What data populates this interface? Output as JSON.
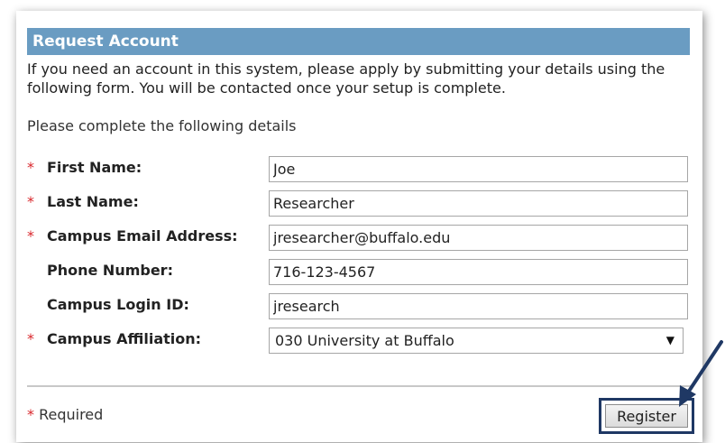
{
  "panel": {
    "title": "Request Account",
    "intro": "If you need an account in this system, please apply by submitting your details using the following form. You will be contacted once your setup is complete.",
    "subtitle": "Please complete the following details"
  },
  "form": {
    "required_marker": "*",
    "first_name": {
      "label": "First Name:",
      "value": "Joe",
      "required": true
    },
    "last_name": {
      "label": "Last Name:",
      "value": "Researcher",
      "required": true
    },
    "email": {
      "label": "Campus Email Address:",
      "value": "jresearcher@buffalo.edu",
      "required": true
    },
    "phone": {
      "label": "Phone Number:",
      "value": "716-123-4567",
      "required": false
    },
    "login_id": {
      "label": "Campus Login ID:",
      "value": "jresearch",
      "required": false
    },
    "affiliation": {
      "label": "Campus Affiliation:",
      "value": "030 University at Buffalo",
      "required": true
    }
  },
  "footer": {
    "required_note": "Required",
    "register_label": "Register"
  },
  "colors": {
    "header_bg": "#6a9cc2",
    "required_star": "#d9262b",
    "annotation": "#1f3864"
  },
  "icons": {
    "dropdown": "chevron-down-icon",
    "annotation": "arrow-annotation-icon"
  }
}
